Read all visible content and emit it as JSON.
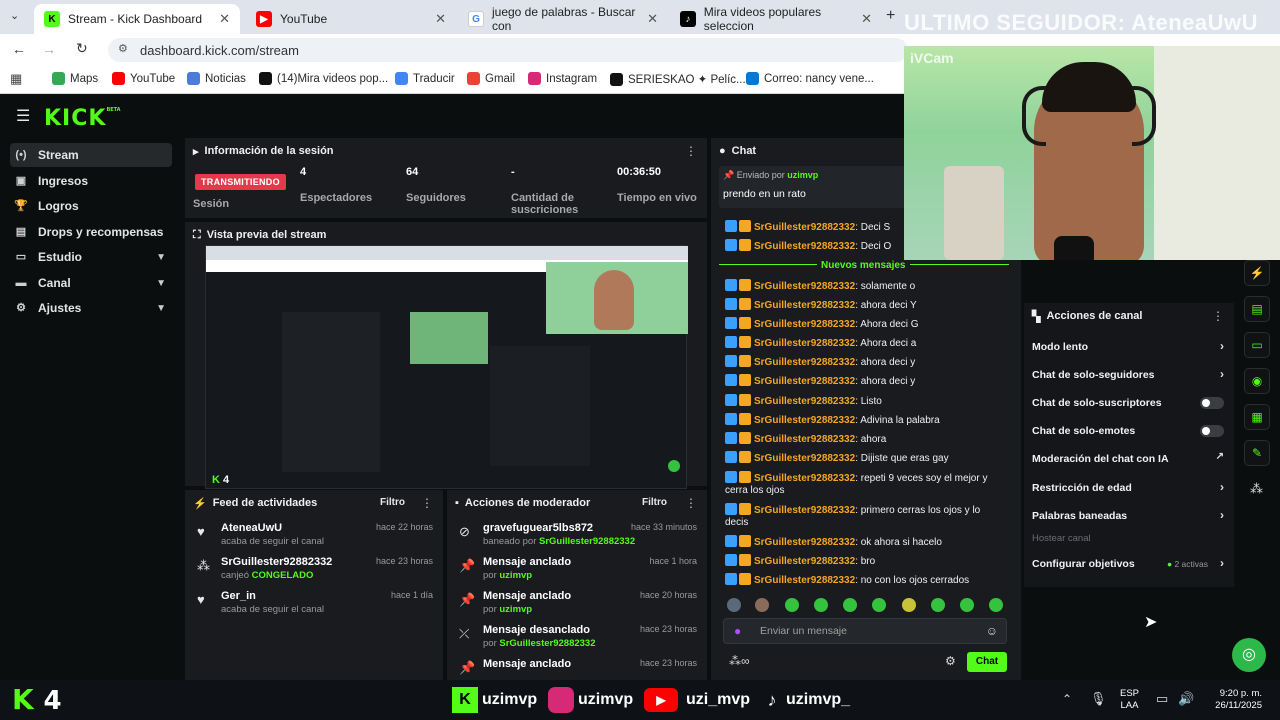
{
  "browser": {
    "tabs": [
      {
        "label": "Stream - Kick Dashboard",
        "icon": "kick-icon",
        "color": "#53fc18"
      },
      {
        "label": "YouTube",
        "icon": "youtube-icon",
        "color": "#ff0000"
      },
      {
        "label": "juego de palabras - Buscar con",
        "icon": "google-icon",
        "color": "#4285f4"
      },
      {
        "label": "Mira videos populares seleccion",
        "icon": "tiktok-icon",
        "color": "#000000"
      }
    ],
    "url": "dashboard.kick.com/stream",
    "bookmarks": [
      "Maps",
      "YouTube",
      "Noticias",
      "(14)Mira videos pop...",
      "Traducir",
      "Gmail",
      "Instagram",
      "SERIESKAO ✦ Pelíc...",
      "Correo: nancy vene..."
    ]
  },
  "overlay": {
    "top_text": "ULTIMO SEGUIDOR: AteneaUwU",
    "webcam_label": "iVCam"
  },
  "sidebar": {
    "items": [
      {
        "label": "Stream",
        "icon": "live-icon"
      },
      {
        "label": "Ingresos",
        "icon": "wallet-icon"
      },
      {
        "label": "Logros",
        "icon": "trophy-icon"
      },
      {
        "label": "Drops y recompensas",
        "icon": "gift-icon"
      },
      {
        "label": "Estudio",
        "icon": "monitor-icon"
      },
      {
        "label": "Canal",
        "icon": "channel-icon"
      },
      {
        "label": "Ajustes",
        "icon": "gear-icon"
      }
    ]
  },
  "session": {
    "title": "Información de la sesión",
    "badge": "TRANSMITIENDO",
    "badge_label": "Sesión",
    "stats": [
      {
        "value": "4",
        "label": "Espectadores"
      },
      {
        "value": "64",
        "label": "Seguidores"
      },
      {
        "value": "-",
        "label": "Cantidad de suscriciones"
      },
      {
        "value": "00:36:50",
        "label": "Tiempo en vivo"
      }
    ]
  },
  "preview": {
    "title": "Vista previa del stream",
    "viewers": "4"
  },
  "feed": {
    "title": "Feed de actividades",
    "filter": "Filtro",
    "items": [
      {
        "user": "AteneaUwU",
        "detail": "acaba de seguir el canal",
        "time": "hace 22 horas"
      },
      {
        "user": "SrGuillester92882332",
        "detail_prefix": "canjeó ",
        "detail_highlight": "CONGELADO",
        "time": "hace 23 horas"
      },
      {
        "user": "Ger_in",
        "detail": "acaba de seguir el canal",
        "time": "hace 1 día"
      }
    ]
  },
  "modactions": {
    "title": "Acciones de moderador",
    "filter": "Filtro",
    "items": [
      {
        "title": "gravefuguear5lbs872",
        "by_prefix": "baneado por ",
        "by": "SrGuillester92882332",
        "time": "hace 33 minutos"
      },
      {
        "title": "Mensaje anclado",
        "by_prefix": "por ",
        "by": "uzimvp",
        "time": "hace 1 hora"
      },
      {
        "title": "Mensaje anclado",
        "by_prefix": "por ",
        "by": "uzimvp",
        "time": "hace 20 horas"
      },
      {
        "title": "Mensaje desanclado",
        "by_prefix": "por ",
        "by": "SrGuillester92882332",
        "time": "hace 23 horas"
      },
      {
        "title": "Mensaje anclado",
        "by_prefix": "",
        "by": "",
        "time": "hace 23 horas"
      }
    ]
  },
  "chat": {
    "title": "Chat",
    "pinned_prefix": "Enviado por",
    "pinned_user": "uzimvp",
    "pinned_text": "prendo en un rato",
    "new_messages": "Nuevos mensajes",
    "user": "SrGuillester92882332",
    "messages_before": [
      "Deci S",
      "Deci O"
    ],
    "messages": [
      "solamente o",
      "ahora deci Y",
      "Ahora deci G",
      "Ahora deci a",
      "ahora deci y",
      "ahora deci y",
      "Listo",
      "Adivina la palabra",
      "ahora",
      "Dijiste que eras gay",
      "repeti 9 veces soy el mejor y cerra los ojos",
      "primero cerras los ojos y lo decis",
      "ok ahora si hacelo",
      "bro",
      "no con los ojos cerrados"
    ],
    "input_placeholder": "Enviar un mensaje",
    "send": "Chat"
  },
  "channel_actions": {
    "title": "Acciones de canal",
    "items": [
      {
        "label": "Modo lento",
        "control": "chevron"
      },
      {
        "label": "Chat de solo-seguidores",
        "control": "chevron"
      },
      {
        "label": "Chat de solo-suscriptores",
        "control": "toggle"
      },
      {
        "label": "Chat de solo-emotes",
        "control": "toggle"
      },
      {
        "label": "Moderación del chat con IA",
        "control": "external"
      },
      {
        "label": "Restricción de edad",
        "control": "chevron"
      },
      {
        "label": "Palabras baneadas",
        "control": "chevron"
      },
      {
        "label": "Hostear canal",
        "control": "none",
        "disabled": true
      },
      {
        "label": "Configurar objetivos",
        "control": "chevron",
        "extra": "2 activas"
      }
    ]
  },
  "stream_overlay": {
    "viewer_count": "4"
  },
  "taskbar": {
    "apps": [
      "uzimvp",
      "uzimvp",
      "uzi_mvp",
      "uzimvp_"
    ],
    "lang": "ESP",
    "lang2": "LAA",
    "time": "9:20 p. m.",
    "date": "26/11/2025"
  },
  "colors": {
    "kick_green": "#53fc18",
    "live_red": "#e2394b",
    "chat_user": "#f5a623"
  }
}
